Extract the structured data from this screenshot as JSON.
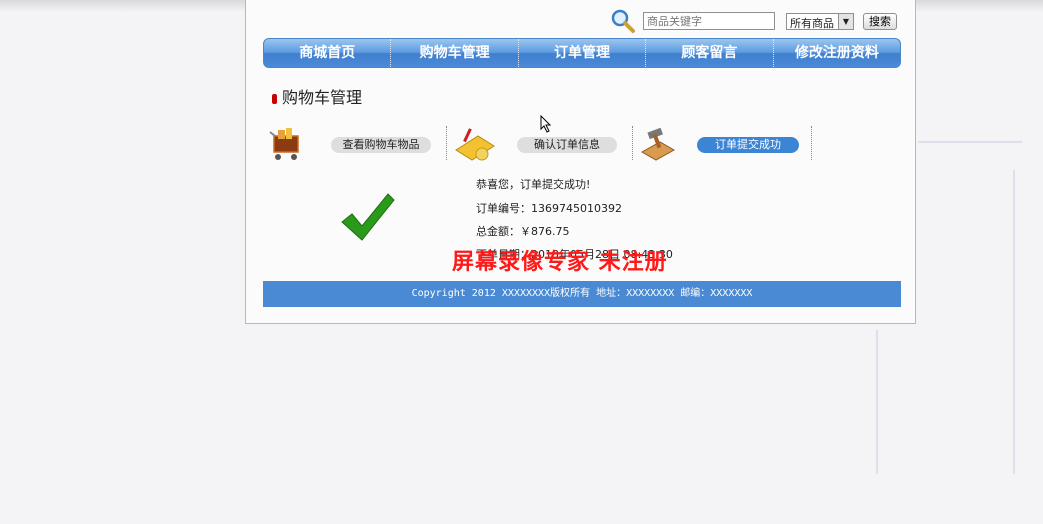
{
  "header": {
    "search_placeholder": "商品关键字",
    "category_selected": "所有商品",
    "search_button": "搜索"
  },
  "nav": {
    "items": [
      {
        "label": "商城首页"
      },
      {
        "label": "购物车管理"
      },
      {
        "label": "订单管理"
      },
      {
        "label": "顾客留言"
      },
      {
        "label": "修改注册资料"
      }
    ]
  },
  "section": {
    "title": "购物车管理"
  },
  "steps": [
    {
      "label": "查看购物车物品",
      "icon": "shopping-cart-icon",
      "active": false
    },
    {
      "label": "确认订单信息",
      "icon": "calculator-icon",
      "active": false
    },
    {
      "label": "订单提交成功",
      "icon": "hammer-icon",
      "active": true
    }
  ],
  "result": {
    "message": "恭喜您，订单提交成功!",
    "order_no": "订单编号：1369745010392",
    "total": "总金额：￥876.75",
    "date": "下单日期：2013年05月28日 08:43:30"
  },
  "footer": {
    "text": "Copyright 2012 XXXXXXXX版权所有 地址：XXXXXXXX  邮编：XXXXXXX"
  },
  "watermark": {
    "text": "屏幕录像专家 未注册"
  },
  "colors": {
    "nav_blue": "#4a8ad6",
    "footer_blue": "#4a8ad4",
    "success_green": "#2a9a1a",
    "watermark_red": "#ff1a1a"
  }
}
